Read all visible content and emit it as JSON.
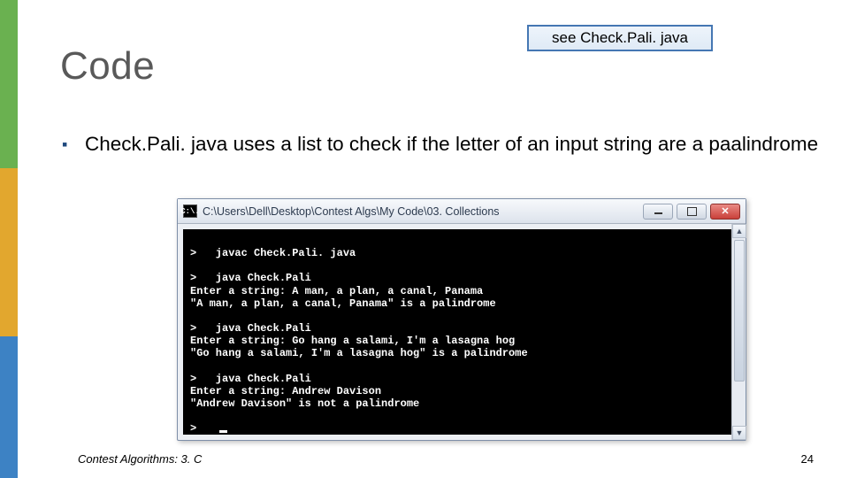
{
  "title": "Code",
  "see_box": "see Check.Pali. java",
  "bullet_text": "Check.Pali. java uses a list to check if the letter of an input string are a paalindrome",
  "console": {
    "window_title": "C:\\Users\\Dell\\Desktop\\Contest Algs\\My Code\\03. Collections",
    "lines": "\n>   javac Check.Pali. java\n\n>   java Check.Pali\nEnter a string: A man, a plan, a canal, Panama\n\"A man, a plan, a canal, Panama\" is a palindrome\n\n>   java Check.Pali\nEnter a string: Go hang a salami, I'm a lasagna hog\n\"Go hang a salami, I'm a lasagna hog\" is a palindrome\n\n>   java Check.Pali\nEnter a string: Andrew Davison\n\"Andrew Davison\" is not a palindrome\n\n>   "
  },
  "footer_left": "Contest Algorithms: 3. C",
  "footer_right": "24"
}
